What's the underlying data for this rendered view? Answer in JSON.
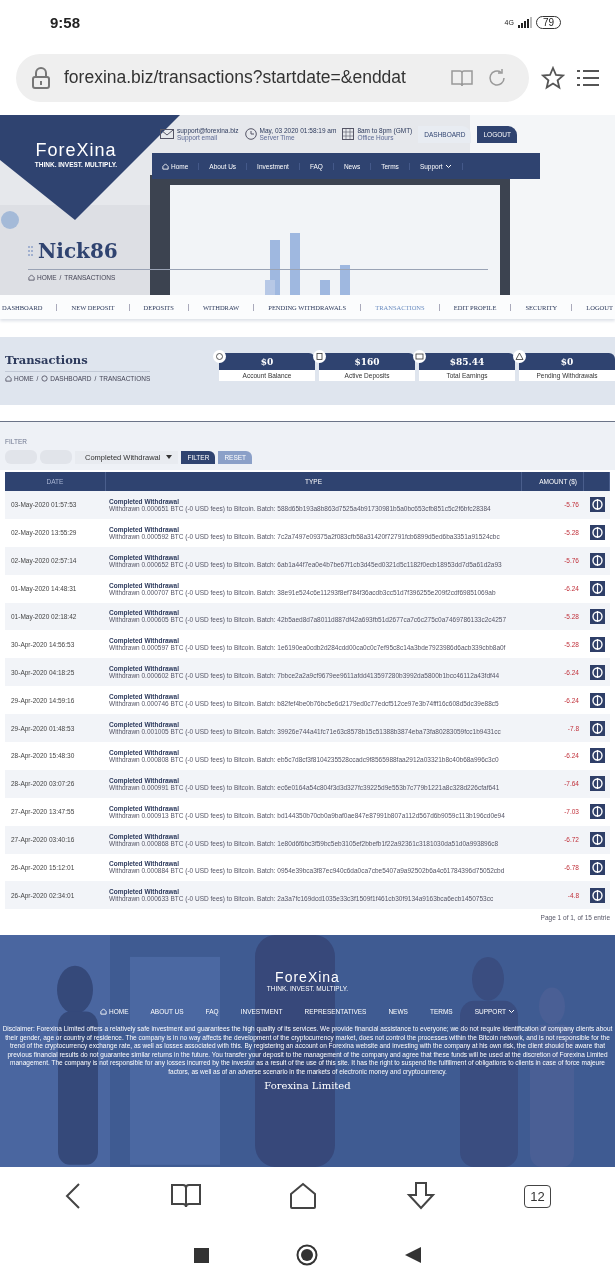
{
  "status_bar": {
    "time": "9:58",
    "network": "4G",
    "battery": "79"
  },
  "browser": {
    "url": "forexina.biz/transactions?startdate=&enddat",
    "tab_count": "12"
  },
  "site_header": {
    "logo": "ForeXina",
    "tagline": "THINK. INVEST. MULTIPLY.",
    "contacts": [
      {
        "kind": "mail",
        "value": "support@forexina.biz",
        "label": "Support email"
      },
      {
        "kind": "clock",
        "value": "May, 03 2020 01:58:19 am",
        "label": "Server Time"
      },
      {
        "kind": "calendar",
        "value": "8am to 8pm (GMT)",
        "label": "Office Hours"
      }
    ],
    "buttons": [
      {
        "label": "DASHBOARD",
        "primary": false
      },
      {
        "label": "LOGOUT",
        "primary": true
      }
    ],
    "nav": [
      {
        "label": "Home",
        "kind": "home"
      },
      {
        "label": "About Us",
        "kind": "link"
      },
      {
        "label": "Investment",
        "kind": "link"
      },
      {
        "label": "FAQ",
        "kind": "link"
      },
      {
        "label": "News",
        "kind": "link"
      },
      {
        "label": "Terms",
        "kind": "link"
      },
      {
        "label": "Support",
        "kind": "dropdown"
      }
    ],
    "username": "Nick86",
    "breadcrumb": [
      {
        "label": "HOME",
        "kind": "home"
      },
      {
        "label": "TRANSACTIONS",
        "kind": "plain"
      }
    ],
    "separator": "/"
  },
  "account_nav": [
    {
      "label": "DASHBOARD",
      "selected": false
    },
    {
      "label": "NEW DEPOSIT",
      "selected": false
    },
    {
      "label": "DEPOSITS",
      "selected": false
    },
    {
      "label": "WITHDRAW",
      "selected": false
    },
    {
      "label": "PENDING WITHDRAWALS",
      "selected": false
    },
    {
      "label": "TRANSACTIONS",
      "selected": true
    },
    {
      "label": "EDIT PROFILE",
      "selected": false
    },
    {
      "label": "SECURITY",
      "selected": false
    },
    {
      "label": "LOGOUT",
      "selected": false
    }
  ],
  "page": {
    "title": "Transactions",
    "breadcrumb": [
      {
        "label": "HOME",
        "kind": "home"
      },
      {
        "label": "DASHBOARD",
        "kind": "dashboard"
      },
      {
        "label": "TRANSACTIONS",
        "kind": "plain"
      }
    ],
    "separator": "/",
    "stats": [
      {
        "kind": "balance",
        "value": "$0",
        "label": "Account Balance"
      },
      {
        "kind": "deposit",
        "value": "$160",
        "label": "Active Deposits"
      },
      {
        "kind": "earnings",
        "value": "$85.44",
        "label": "Total Earnings"
      },
      {
        "kind": "pending",
        "value": "$0",
        "label": "Pending Withdrawals"
      }
    ]
  },
  "filter": {
    "label": "FILTER",
    "fields": [
      {
        "kind": "date"
      },
      {
        "kind": "date"
      }
    ],
    "select": "Completed Withdrawal",
    "buttons": [
      {
        "label": "FILTER",
        "primary": true
      },
      {
        "label": "RESET",
        "primary": false
      }
    ]
  },
  "table": {
    "columns": [
      "DATE",
      "TYPE",
      "AMOUNT ($)"
    ],
    "rows": [
      {
        "date": "03-May-2020 01:57:53",
        "type": "Completed Withdrawal",
        "details": "Withdrawn 0.000651 BTC (-0 USD fees) to Bitcoin. Batch: 588d65b193a8b863d7525a4b91730981b5a0bc653cfb851c5c2f6bfc28384",
        "amount": "-5.76"
      },
      {
        "date": "02-May-2020 13:55:29",
        "type": "Completed Withdrawal",
        "details": "Withdrawn 0.000592 BTC (-0 USD fees) to Bitcoin. Batch: 7c2a7497e09375a2f083cfb58a31420f72791fcb6899d5ed6ba3351a91524cbc",
        "amount": "-5.28"
      },
      {
        "date": "02-May-2020 02:57:14",
        "type": "Completed Withdrawal",
        "details": "Withdrawn 0.000652 BTC (-0 USD fees) to Bitcoin. Batch: 6ab1a44f7ea0e4b7be67f1cb3d45ed0321d5c1182f0ecb18953dd7d5a61d2a93",
        "amount": "-5.76"
      },
      {
        "date": "01-May-2020 14:48:31",
        "type": "Completed Withdrawal",
        "details": "Withdrawn 0.000707 BTC (-0 USD fees) to Bitcoin. Batch: 38e91e524c6e11293f8ef784f36acdb3cc51d7f396255e209f2cdf69851069ab",
        "amount": "-6.24"
      },
      {
        "date": "01-May-2020 02:18:42",
        "type": "Completed Withdrawal",
        "details": "Withdrawn 0.000605 BTC (-0 USD fees) to Bitcoin. Batch: 42b5aed8d7a8011d887df42a693fb51d2677ca7c6c275c0a7469786133c2c4257",
        "amount": "-5.28"
      },
      {
        "date": "30-Apr-2020 14:56:53",
        "type": "Completed Withdrawal",
        "details": "Withdrawn 0.000597 BTC (-0 USD fees) to Bitcoin. Batch: 1e6190ea0cdb2d284cdd00ca0c0c7ef95c8c14a3bde7923986d6acb339cbb8a0f",
        "amount": "-5.28"
      },
      {
        "date": "30-Apr-2020 04:18:25",
        "type": "Completed Withdrawal",
        "details": "Withdrawn 0.000602 BTC (-0 USD fees) to Bitcoin. Batch: 7bbce2a2a9cf9679ee9611afdd413597280b3992da5800b1bcc46112a43fdf44",
        "amount": "-6.24"
      },
      {
        "date": "29-Apr-2020 14:59:16",
        "type": "Completed Withdrawal",
        "details": "Withdrawn 0.000746 BTC (-0 USD fees) to Bitcoin. Batch: b82fef4be0b76bc5e6d2179ed0c77edcf512ce97e3b74fff16c608d5dc39e88c5",
        "amount": "-6.24"
      },
      {
        "date": "29-Apr-2020 01:48:53",
        "type": "Completed Withdrawal",
        "details": "Withdrawn 0.001005 BTC (-0 USD fees) to Bitcoin. Batch: 39926e744a41fc71e63c8578b15c51388b3874eba73fa80283059fcc1b9431cc",
        "amount": "-7.8"
      },
      {
        "date": "28-Apr-2020 15:48:30",
        "type": "Completed Withdrawal",
        "details": "Withdrawn 0.000808 BTC (-0 USD fees) to Bitcoin. Batch: eb5c7d8cf3f8104235528ccadc9f8565988faa2912a03321b8c40b68a996c3c0",
        "amount": "-6.24"
      },
      {
        "date": "28-Apr-2020 03:07:26",
        "type": "Completed Withdrawal",
        "details": "Withdrawn 0.000991 BTC (-0 USD fees) to Bitcoin. Batch: ec6e0164a54c804f3d3d327fc39225d9e553b7c779b1221a8c328d226cfaf641",
        "amount": "-7.64"
      },
      {
        "date": "27-Apr-2020 13:47:55",
        "type": "Completed Withdrawal",
        "details": "Withdrawn 0.000913 BTC (-0 USD fees) to Bitcoin. Batch: bd144350b70cb0a9baf0ae847e87991b807a112d567d6b9059c113b196cd0e94",
        "amount": "-7.03"
      },
      {
        "date": "27-Apr-2020 03:40:16",
        "type": "Completed Withdrawal",
        "details": "Withdrawn 0.000868 BTC (-0 USD fees) to Bitcoin. Batch: 1e80d6f6bc3f59bc5eb3105ef2bbefb1f22a92361c3181030da51d0a993896c8",
        "amount": "-6.72"
      },
      {
        "date": "26-Apr-2020 15:12:01",
        "type": "Completed Withdrawal",
        "details": "Withdrawn 0.000884 BTC (-0 USD fees) to Bitcoin. Batch: 0954e39bca3f87ec940c6da0ca7cbe5407a9a92502b6a4c61784396d75052cbd",
        "amount": "-6.78"
      },
      {
        "date": "26-Apr-2020 02:34:01",
        "type": "Completed Withdrawal",
        "details": "Withdrawn 0.000633 BTC (-0 USD fees) to Bitcoin. Batch: 2a3a7fc169dcd1035e33c3f1509f1f461cb30f9134a9163bca6ecb1450753cc",
        "amount": "-4.8"
      }
    ],
    "pagination": "Page 1 of 1, of 15 entrie"
  },
  "footer": {
    "logo": "ForeXina",
    "tagline": "THINK. INVEST. MULTIPLY.",
    "nav": [
      {
        "label": "HOME",
        "kind": "home"
      },
      {
        "label": "ABOUT US",
        "kind": "link"
      },
      {
        "label": "FAQ",
        "kind": "link"
      },
      {
        "label": "INVESTMENT",
        "kind": "link"
      },
      {
        "label": "REPRESENTATIVES",
        "kind": "link"
      },
      {
        "label": "NEWS",
        "kind": "link"
      },
      {
        "label": "TERMS",
        "kind": "link"
      },
      {
        "label": "SUPPORT",
        "kind": "dropdown"
      }
    ],
    "disclaimer": "Disclaimer: Forexina Limited offers a relatively safe investment and guarantees the high quality of its services. We provide financial assistance to everyone; we do not require identification of company clients about their gender, age or country of residence. The company is in no way affects the development of the cryptocurrency market, does not control the processes within the Bitcoin network, and is not responsible for the trend of the cryptocurrency exchange rate, as well as losses associated with this. By registering an account on Forexina website and investing with the company at his own risk, the client should be aware that previous financial results do not guarantee similar returns in the future. You transfer your deposit to the management of the company and agree that these funds will be used at the discretion of Forexina Limited management. The company is not responsible for any losses incurred by the investor as a result of the use of this site. It has the right to suspend the fulfillment of obligations to clients in case of force majeure factors, as well as of an adverse scenario in the markets of electronic money and cryptocurrency.",
    "company": "Forexina Limited"
  }
}
